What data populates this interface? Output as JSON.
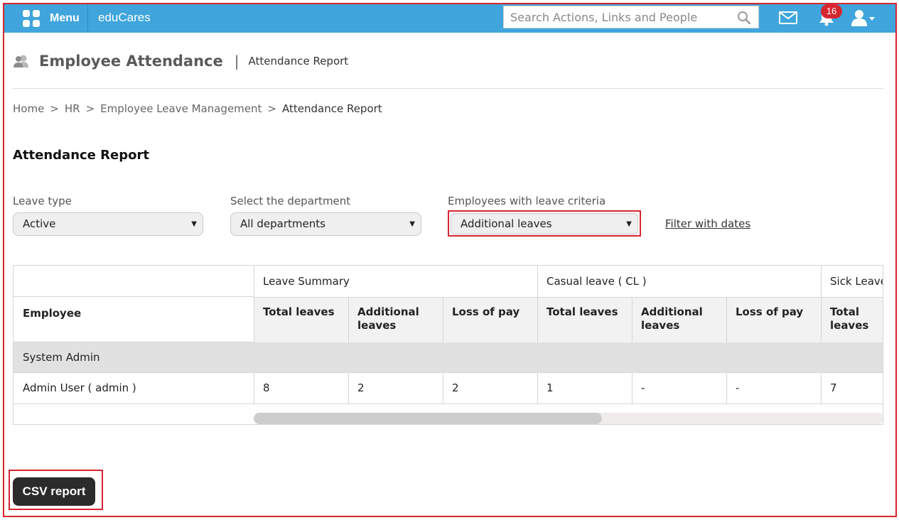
{
  "topbar": {
    "menu_label": "Menu",
    "brand": "eduCares",
    "search_placeholder": "Search Actions, Links and People",
    "notification_count": "16",
    "bar_color": "#3fa5dc",
    "badge_color": "#d62630"
  },
  "header": {
    "title": "Employee Attendance",
    "separator": "|",
    "subtitle": "Attendance Report"
  },
  "breadcrumb": {
    "items": [
      "Home",
      "HR",
      "Employee Leave Management"
    ],
    "current": "Attendance Report",
    "separator": ">"
  },
  "section_title": "Attendance Report",
  "filters": {
    "leave_type": {
      "label": "Leave type",
      "value": "Active"
    },
    "department": {
      "label": "Select the department",
      "value": "All departments"
    },
    "criteria": {
      "label": "Employees with leave criteria",
      "value": "Additional leaves"
    },
    "filter_link": "Filter with dates"
  },
  "table": {
    "employee_header": "Employee",
    "groups": [
      "Leave Summary",
      "Casual leave ( CL )",
      "Sick Leave"
    ],
    "columns": [
      "Total leaves",
      "Additional leaves",
      "Loss of pay",
      "Total leaves",
      "Additional leaves",
      "Loss of pay",
      "Total leaves"
    ],
    "group_row": "System Admin",
    "rows": [
      {
        "employee": "Admin User ( admin )",
        "values": [
          "8",
          "2",
          "2",
          "1",
          "-",
          "-",
          "7"
        ]
      }
    ]
  },
  "csv_button": "CSV report",
  "annotation_color": "#d62630"
}
